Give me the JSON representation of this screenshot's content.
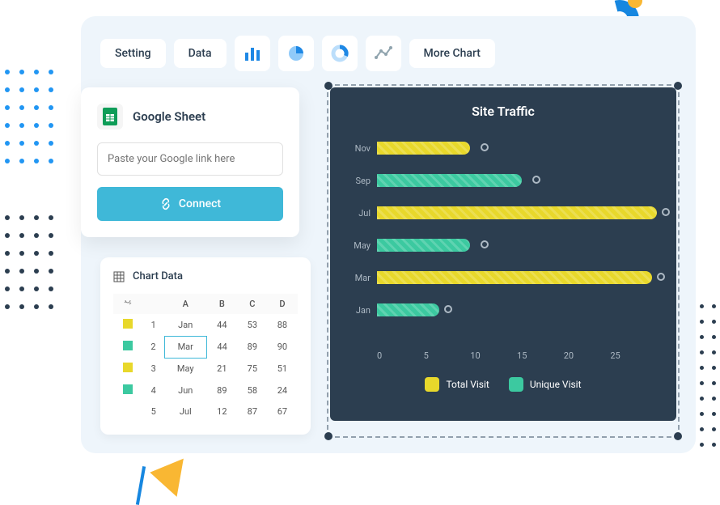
{
  "toolbar": {
    "setting": "Setting",
    "data": "Data",
    "more": "More Chart"
  },
  "sheet": {
    "title": "Google Sheet",
    "placeholder": "Paste your Google link here",
    "connect": "Connect"
  },
  "data_table": {
    "title": "Chart Data",
    "headers": [
      "",
      "",
      "A",
      "B",
      "C",
      "D"
    ],
    "rows": [
      {
        "sw": "y",
        "n": "1",
        "a": "Jan",
        "b": "44",
        "c": "53",
        "d": "88"
      },
      {
        "sw": "g",
        "n": "2",
        "a": "Mar",
        "b": "44",
        "c": "89",
        "d": "90"
      },
      {
        "sw": "y",
        "n": "3",
        "a": "May",
        "b": "21",
        "c": "75",
        "d": "51"
      },
      {
        "sw": "g",
        "n": "4",
        "a": "Jun",
        "b": "89",
        "c": "58",
        "d": "24"
      },
      {
        "sw": "",
        "n": "5",
        "a": "Jul",
        "b": "12",
        "c": "87",
        "d": "67"
      }
    ]
  },
  "legend": {
    "total": "Total Visit",
    "unique": "Unique Visit"
  },
  "chart_data": {
    "type": "bar",
    "title": "Site Traffic",
    "orientation": "horizontal",
    "ylabel": "",
    "xlabel": "",
    "xlim": [
      0,
      27
    ],
    "x_ticks": [
      0,
      5,
      10,
      15,
      20,
      25
    ],
    "categories": [
      "Nov",
      "Sep",
      "Jul",
      "May",
      "Mar",
      "Jan"
    ],
    "series": [
      {
        "name": "Total Visit",
        "color": "#e8d82b",
        "values": [
          9,
          null,
          27,
          null,
          26.5,
          null
        ]
      },
      {
        "name": "Unique Visit",
        "color": "#3cc9a0",
        "values": [
          null,
          14,
          null,
          9,
          null,
          6
        ]
      }
    ],
    "markers": [
      10,
      15,
      27.5,
      10,
      27,
      6.5
    ]
  }
}
